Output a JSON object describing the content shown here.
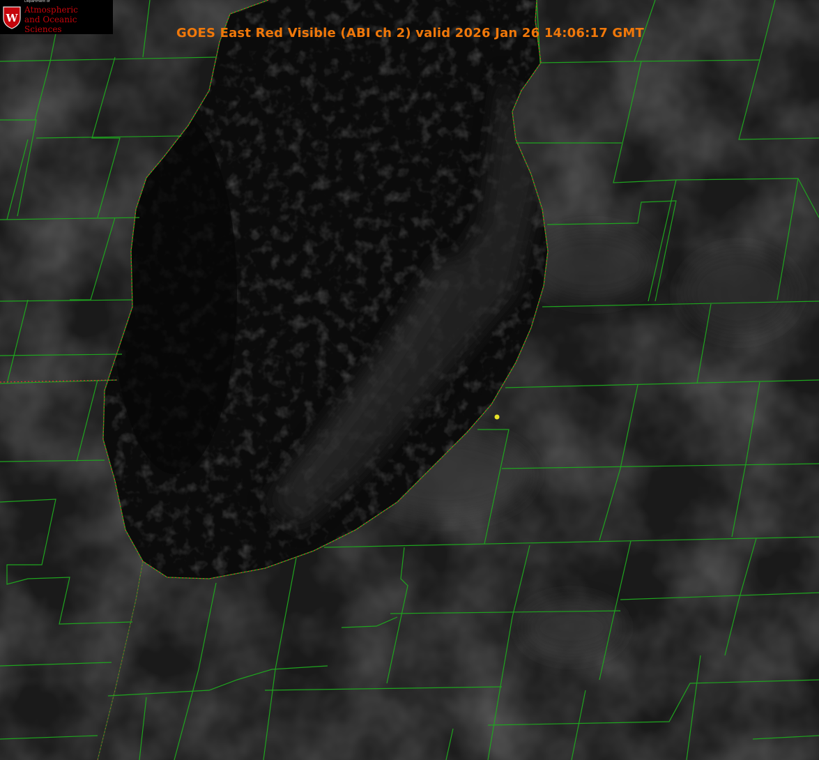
{
  "title": "GOES East Red Visible (ABI ch 2) valid 2026 Jan 26 14:06:17 GMT",
  "logo": {
    "department": "Department of",
    "line1": "Atmospheric",
    "line2": "and Oceanic Sciences",
    "crest_letter": "W",
    "crest_icon": "uw-crest-icon",
    "color": "#c5050c"
  },
  "map": {
    "county_line_color": "#1fa51f",
    "state_line_color": "#e03030",
    "marker_color": "#e6e22a",
    "title_color": "#f0780a",
    "marker_icon": "station-dot-icon"
  }
}
